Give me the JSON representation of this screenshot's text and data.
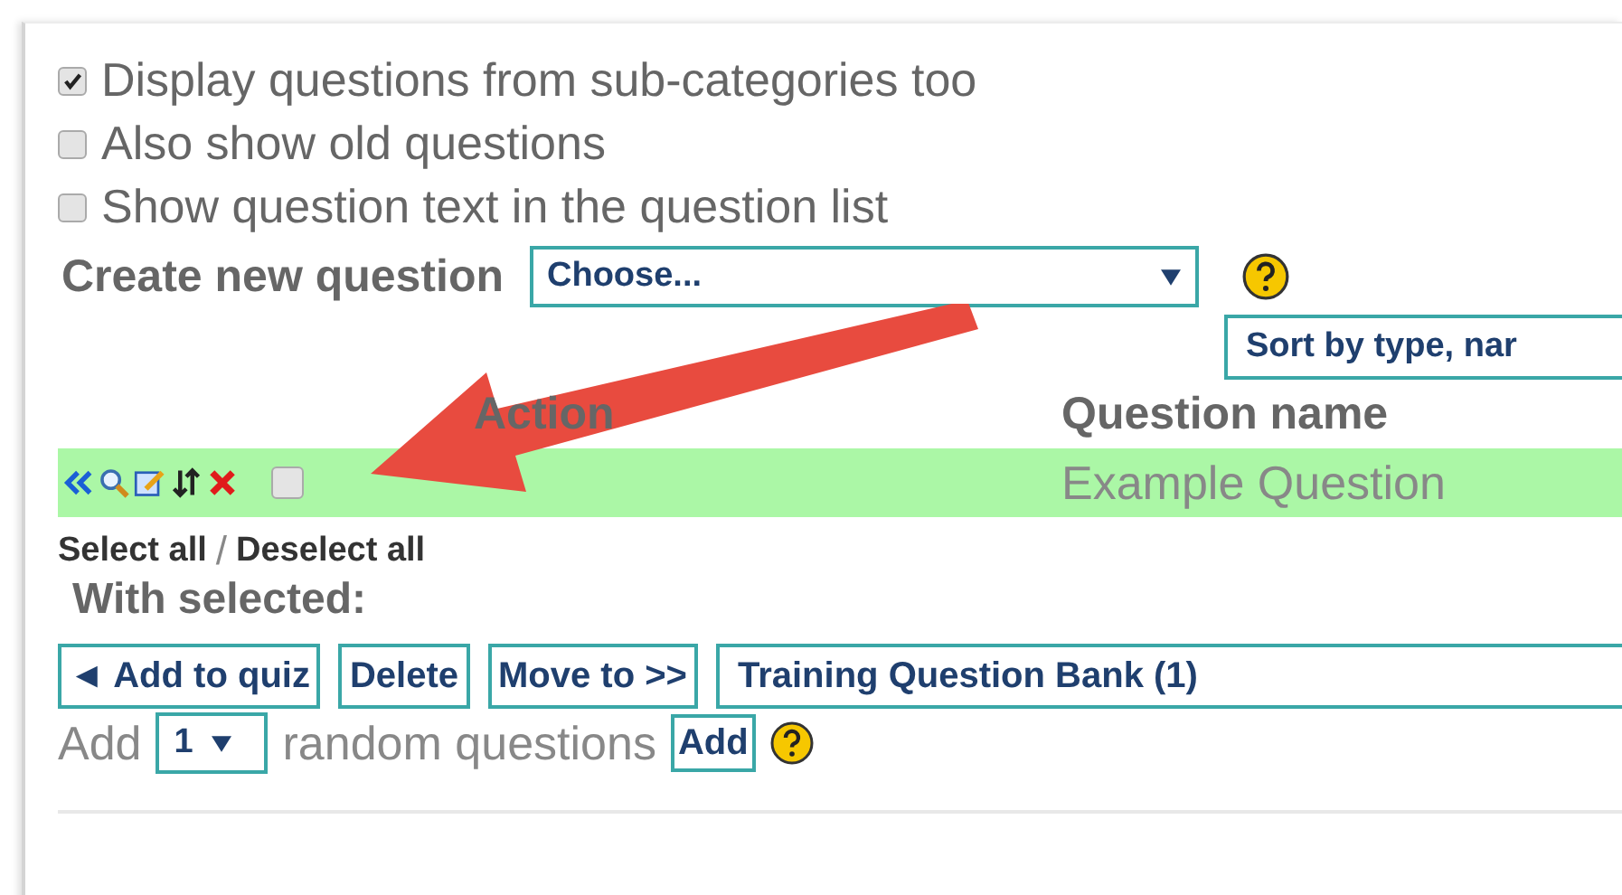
{
  "options": [
    {
      "label": "Display questions from sub-categories too",
      "checked": true
    },
    {
      "label": "Also show old questions",
      "checked": false
    },
    {
      "label": "Show question text in the question list",
      "checked": false
    }
  ],
  "create": {
    "label": "Create new question",
    "select": "Choose..."
  },
  "sort": {
    "select": "Sort by type, nar"
  },
  "table": {
    "columns": [
      "Action",
      "Question name"
    ],
    "rows": [
      {
        "name": "Example Question",
        "selected": false
      }
    ]
  },
  "select_links": [
    "Select all",
    "/",
    "Deselect all"
  ],
  "with_selected": {
    "label": "With selected:",
    "buttons": [
      "◄ Add to quiz",
      "Delete",
      "Move to >>"
    ],
    "category": "Training Question Bank (1)"
  },
  "random": {
    "prefix": "Add",
    "count": "1",
    "suffix": "random questions",
    "button": "Add"
  }
}
